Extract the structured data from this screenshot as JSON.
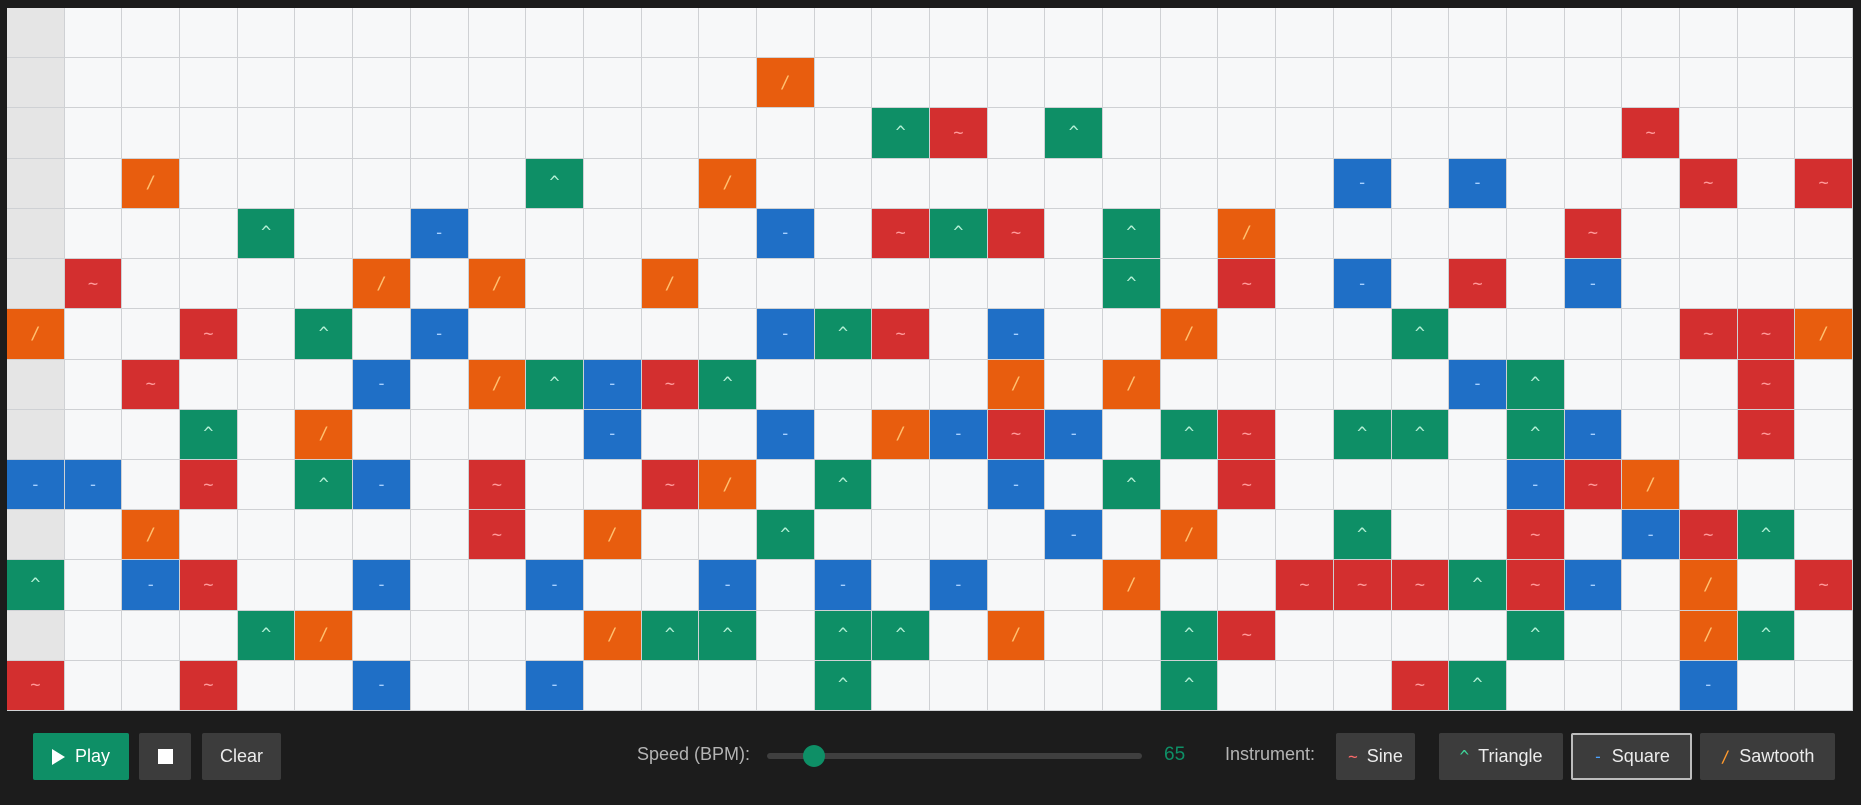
{
  "grid": {
    "columns": 32,
    "rows": [
      "................................",
      ".............w..................",
      "...............ts.t.........s...",
      "..w......t..w..........q.q...s.s",
      "....t..q.....q.sts.t.w.....s....",
      ".s....w.w..w.......t.s.q.s.q....",
      "w..s.t.q.....qts.q..w...t....ssw",
      "..s...q.wtqst....w.w.....qt...s.",
      "...t.w....q..q.wqsq.ts.tt.tq..s.",
      "qq.s.tq.s..sw.t..q.t.s....qsw...",
      "..w.....s.w..t....q.w..t..s.qst.",
      "t.qs..q..q..q.q.q..w..ssstsq.w.s",
      "....tw....wtt.tt.w..ts....t..wt.",
      "s..s..q..q....t.....t...st...q.."
    ],
    "playhead_column": 0,
    "legend": {
      "s": "sine",
      "t": "triangle",
      "q": "square",
      "w": "sawtooth"
    }
  },
  "symbols": {
    "s": "~",
    "t": "^",
    "q": "-",
    "w": "/"
  },
  "controls": {
    "play_label": "Play",
    "clear_label": "Clear",
    "speed_label": "Speed (BPM):",
    "speed_value": "65",
    "speed_min": 40,
    "speed_max": 240,
    "instrument_label": "Instrument:",
    "active_instrument": "square"
  },
  "instruments": [
    {
      "id": "sine",
      "label": "Sine",
      "symbol": "~",
      "color": "#ff6b6b"
    },
    {
      "id": "triangle",
      "label": "Triangle",
      "symbol": "^",
      "color": "#3fd69a"
    },
    {
      "id": "square",
      "label": "Square",
      "symbol": "-",
      "color": "#4da3ff"
    },
    {
      "id": "sawtooth",
      "label": "Sawtooth",
      "symbol": "/",
      "color": "#ff9a2e"
    }
  ],
  "colors": {
    "sine": "#d32f2f",
    "triangle": "#0e8f66",
    "square": "#1f6fc6",
    "sawtooth": "#e85d0e",
    "accent": "#0e8f66"
  }
}
